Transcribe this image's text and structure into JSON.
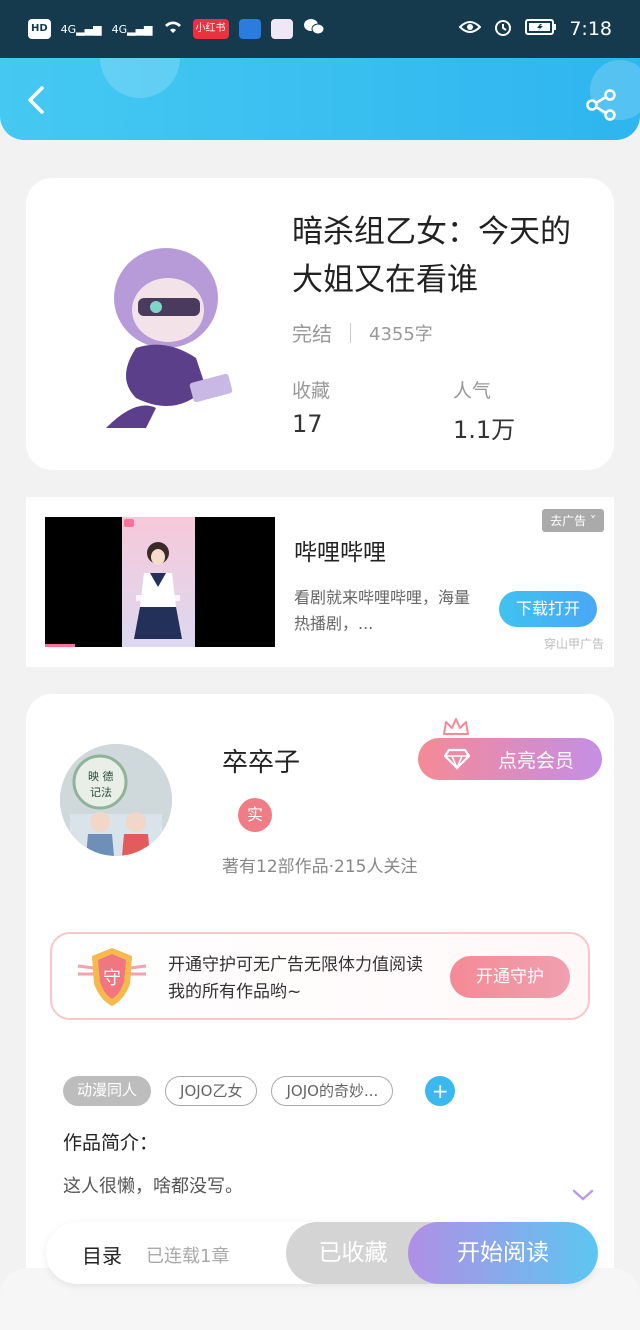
{
  "status_bar": {
    "network": "HD",
    "sim1": "4G",
    "sim2": "4G",
    "app_chip_1": "小红书",
    "time": "7:18"
  },
  "header": {
    "back_icon": "back-arrow-icon",
    "share_icon": "share-icon"
  },
  "book": {
    "title": "暗杀组乙女：今天的大姐又在看谁",
    "status": "完结",
    "word_count": "4355字",
    "collect_label": "收藏",
    "collect_value": "17",
    "popularity_label": "人气",
    "popularity_value": "1.1万"
  },
  "ad": {
    "title": "哔哩哔哩",
    "description": "看剧就来哔哩哔哩，海量热播剧，...",
    "close_label": "去广告 ˅",
    "button_label": "下载打开",
    "source": "穿山甲广告"
  },
  "author": {
    "name": "卒卒子",
    "verified_label": "实",
    "stats": "著有12部作品·215人关注",
    "vip_button": "点亮会员",
    "guard_badge": "守",
    "guard_text": "开通守护可无广告无限体力值阅读我的所有作品哟~",
    "guard_button": "开通守护"
  },
  "tags": [
    "动漫同人",
    "JOJO乙女",
    "JOJO的奇妙..."
  ],
  "intro": {
    "title": "作品简介：",
    "text": "这人很懒，啥都没写。"
  },
  "bottom_bar": {
    "toc_label": "目录",
    "toc_count": "已连载1章",
    "collected_label": "已收藏",
    "read_label": "开始阅读"
  },
  "colors": {
    "header_blue": "#3bbdf0",
    "accent_pink": "#f58a95",
    "accent_purple": "#c58ee6"
  }
}
